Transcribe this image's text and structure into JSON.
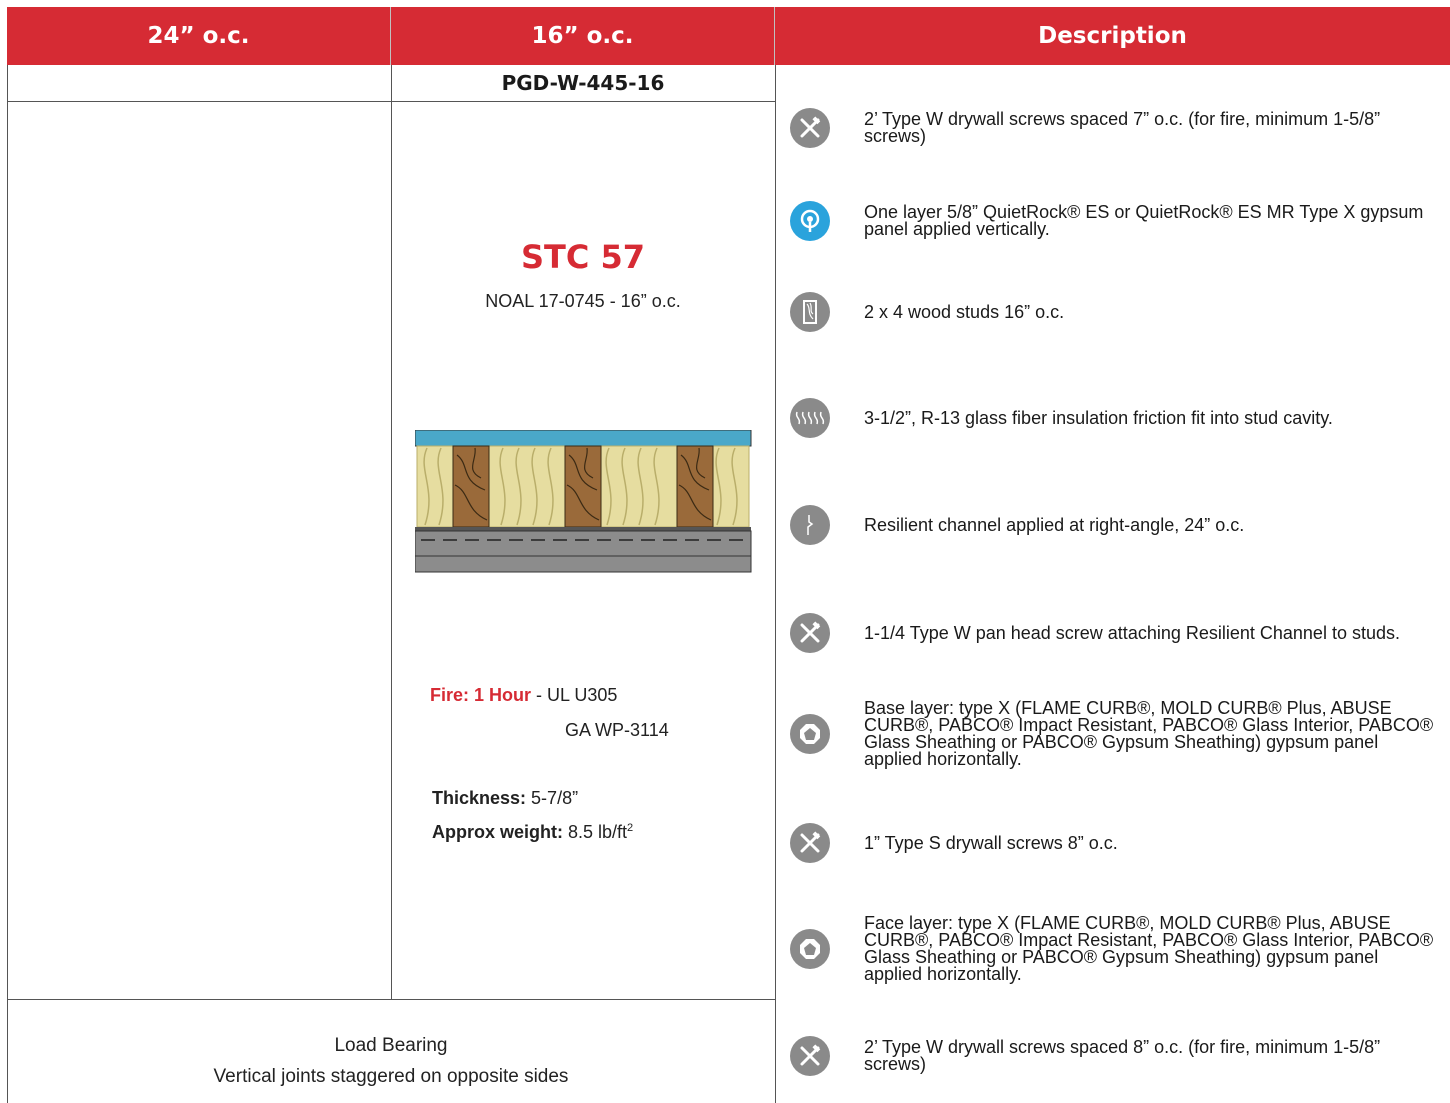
{
  "header": {
    "col1": "24” o.c.",
    "col2": "16” o.c.",
    "col3": "Description"
  },
  "assembly": {
    "code": "PGD-W-445-16",
    "stc": "STC 57",
    "noal": "NOAL 17-0745 - 16” o.c.",
    "fire_label": "Fire: 1 Hour",
    "fire_ul": " - UL U305",
    "fire_ga": "GA WP-3114",
    "thickness_label": "Thickness:",
    "thickness_value": " 5-7/8”",
    "weight_label": "Approx weight:",
    "weight_value": " 8.5 lb/ft",
    "weight_sup": "2"
  },
  "footer": {
    "line1": "Load Bearing",
    "line2": "Vertical joints staggered on opposite sides"
  },
  "descriptions": [
    {
      "icon": "screw-tools-icon",
      "text": "2’ Type W drywall screws spaced 7” o.c. (for fire, minimum 1-5/8” screws)"
    },
    {
      "icon": "quietrock-icon",
      "text": "One layer 5/8” QuietRock® ES or QuietRock® ES MR Type X gypsum panel applied vertically."
    },
    {
      "icon": "wood-stud-icon",
      "text": "2 x 4 wood studs 16” o.c."
    },
    {
      "icon": "insulation-icon",
      "text": "3-1/2”, R-13 glass fiber insulation friction fit into stud cavity."
    },
    {
      "icon": "resilient-channel-icon",
      "text": "Resilient channel applied at right-angle, 24” o.c."
    },
    {
      "icon": "screw-tools-icon",
      "text": "1-1/4 Type W pan head screw attaching Resilient Channel to studs."
    },
    {
      "icon": "gypsum-panel-icon",
      "text": "Base layer: type X (FLAME CURB®, MOLD CURB® Plus, ABUSE CURB®, PABCO® Impact Resistant, PABCO® Glass Interior, PABCO® Glass Sheathing or PABCO® Gypsum Sheathing) gypsum panel applied horizontally."
    },
    {
      "icon": "screw-tools-icon",
      "text": "1” Type S drywall screws 8” o.c."
    },
    {
      "icon": "gypsum-panel-icon",
      "text": "Face layer:  type X (FLAME CURB®, MOLD CURB® Plus, ABUSE CURB®, PABCO® Impact Resistant, PABCO® Glass Interior, PABCO® Glass Sheathing or PABCO® Gypsum Sheathing) gypsum panel applied horizontally."
    },
    {
      "icon": "screw-tools-icon",
      "text": "2’ Type W drywall screws spaced 8” o.c. (for fire, minimum 1-5/8” screws)"
    }
  ],
  "colors": {
    "accent_red": "#d62b34",
    "icon_gray": "#8a8a8a",
    "icon_blue": "#2aa3dc"
  }
}
